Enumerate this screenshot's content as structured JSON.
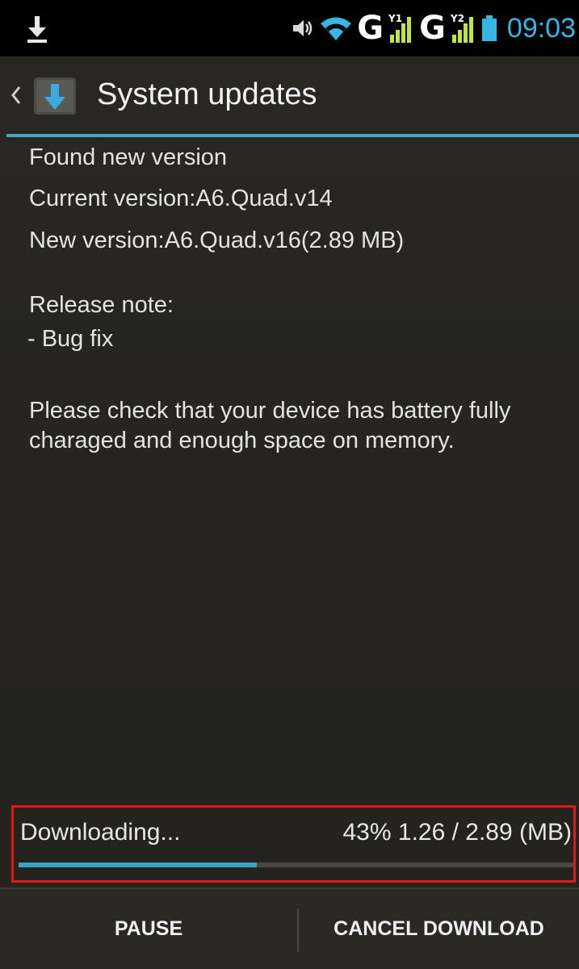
{
  "status_bar": {
    "network_1": "G",
    "network_2": "G",
    "time": "09:03",
    "time_color": "#35b6e5",
    "icons": [
      "download-icon",
      "volume-icon",
      "wifi-icon",
      "signal-sim1-icon",
      "signal-sim2-icon",
      "battery-icon"
    ]
  },
  "action_bar": {
    "title": "System updates",
    "divider_color": "#4aa3c4",
    "icons": [
      "back-chevron-icon",
      "system-update-icon"
    ]
  },
  "content": {
    "found_text": "Found new version",
    "current_version": "Current version:A6.Quad.v14",
    "new_version": "New version:A6.Quad.v16(2.89 MB)",
    "release_note_heading": "Release note:",
    "release_note_item": "- Bug fix",
    "warning_lines": [
      "Please check that your device has battery fully",
      "charaged and enough space on memory."
    ]
  },
  "download": {
    "label": "Downloading...",
    "percent_text": "43%",
    "size_text": "1.26 / 2.89 (MB)",
    "progress_percent": 43,
    "progress_color": "#3aa2c6",
    "highlight_color": "#e01818"
  },
  "buttons": {
    "pause": "PAUSE",
    "cancel": "CANCEL DOWNLOAD"
  }
}
